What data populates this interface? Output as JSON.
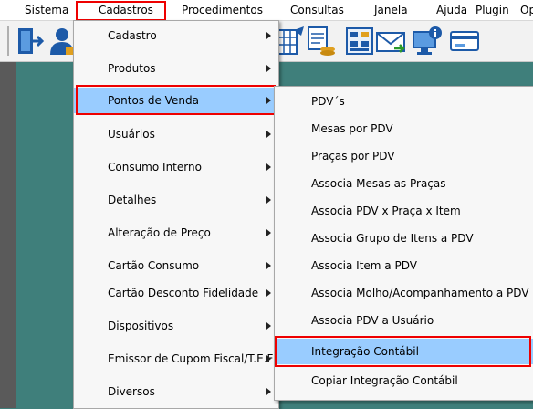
{
  "menubar": {
    "items": [
      "Sistema",
      "Cadastros",
      "Procedimentos",
      "Consultas",
      "Janela",
      "Ajuda",
      "Plugin",
      "Op"
    ]
  },
  "toolbar": {
    "icons": [
      "exit-door-icon",
      "user-icon",
      "table-calc-icon",
      "calculator-icon",
      "notes-coins-icon",
      "calculator-grid-icon",
      "mail-envelope-icon",
      "computer-info-icon",
      "credit-card-icon"
    ]
  },
  "cadastros_menu": {
    "items": [
      {
        "label": "Cadastro",
        "submenu": true
      },
      {
        "label": "Produtos",
        "submenu": true
      },
      {
        "label": "Pontos de Venda",
        "submenu": true
      },
      {
        "label": "Usuários",
        "submenu": true
      },
      {
        "label": "Consumo Interno",
        "submenu": true
      },
      {
        "label": "Detalhes",
        "submenu": true
      },
      {
        "label": "Alteração de Preço",
        "submenu": true
      },
      {
        "label": "Cartão Consumo",
        "submenu": true
      },
      {
        "label": "Cartão Desconto Fidelidade",
        "submenu": true
      },
      {
        "label": "Dispositivos",
        "submenu": true
      },
      {
        "label": "Emissor de Cupom Fiscal/T.E.F",
        "submenu": true
      },
      {
        "label": "Diversos",
        "submenu": true
      }
    ]
  },
  "pontos_submenu": {
    "items": [
      "PDV´s",
      "Mesas por PDV",
      "Praças por PDV",
      "Associa Mesas as Praças",
      "Associa PDV x Praça  x Item",
      "Associa Grupo de Itens a PDV",
      "Associa Item a PDV",
      "Associa Molho/Acompanhamento a PDV",
      "Associa PDV a Usuário",
      "Integração Contábil",
      "Copiar Integração Contábil"
    ]
  },
  "colors": {
    "desktop": "#3f7f7b",
    "highlight": "#99ccff",
    "annotation": "#e00000"
  }
}
